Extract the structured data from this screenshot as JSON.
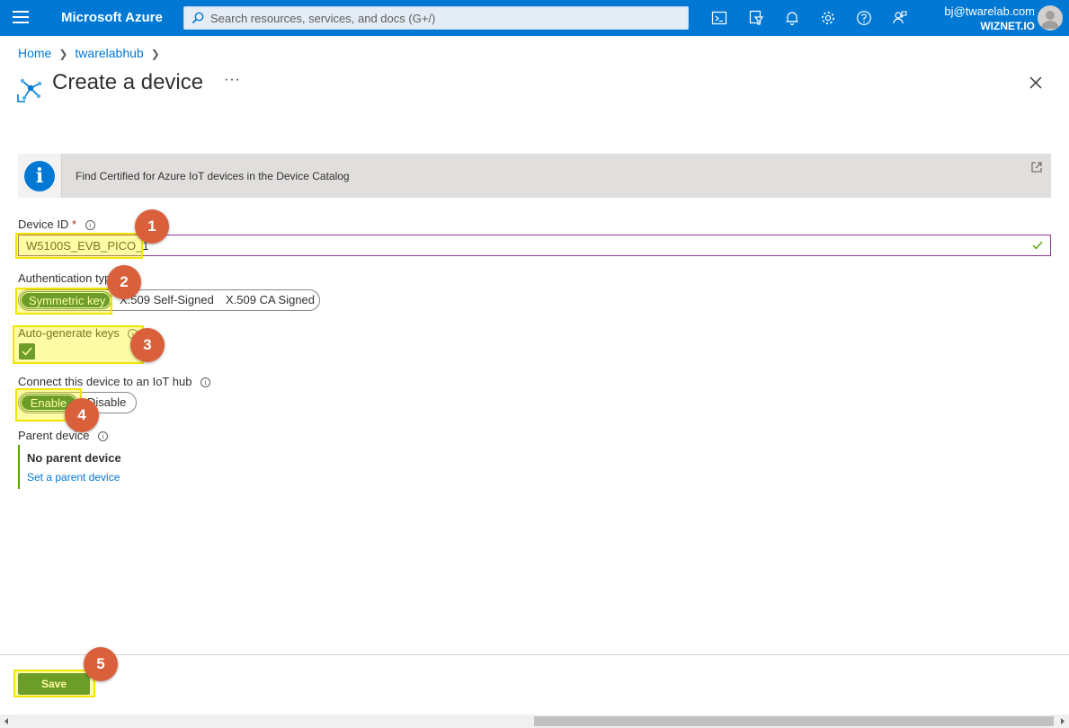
{
  "header": {
    "brand": "Microsoft Azure",
    "search_placeholder": "Search resources, services, and docs (G+/)",
    "account_email": "bj@twarelab.com",
    "account_org": "WIZNET.IO"
  },
  "breadcrumb": {
    "items": [
      "Home",
      "twarelabhub"
    ]
  },
  "page": {
    "title": "Create a device",
    "more": "···"
  },
  "banner": {
    "text": "Find Certified for Azure IoT devices in the Device Catalog"
  },
  "form": {
    "device_id_label": "Device ID",
    "device_id_required": "*",
    "device_id_value": "W5100S_EVB_PICO_1",
    "auth_label": "Authentication type",
    "auth_options": [
      "Symmetric key",
      "X.509 Self-Signed",
      "X.509 CA Signed"
    ],
    "auth_selected": "Symmetric key",
    "auto_keys_label": "Auto-generate keys",
    "auto_keys_checked": true,
    "connect_label": "Connect this device to an IoT hub",
    "connect_options": [
      "Enable",
      "Disable"
    ],
    "connect_selected": "Enable",
    "parent_label": "Parent device",
    "parent_value": "No parent device",
    "parent_link": "Set a parent device"
  },
  "footer": {
    "save_label": "Save"
  },
  "markers": [
    "1",
    "2",
    "3",
    "4",
    "5"
  ],
  "colors": {
    "brand_blue": "#0078d4",
    "primary_green": "#1e6e3f",
    "marker_orange": "#d9603b",
    "highlight_yellow": "#f2e500"
  }
}
